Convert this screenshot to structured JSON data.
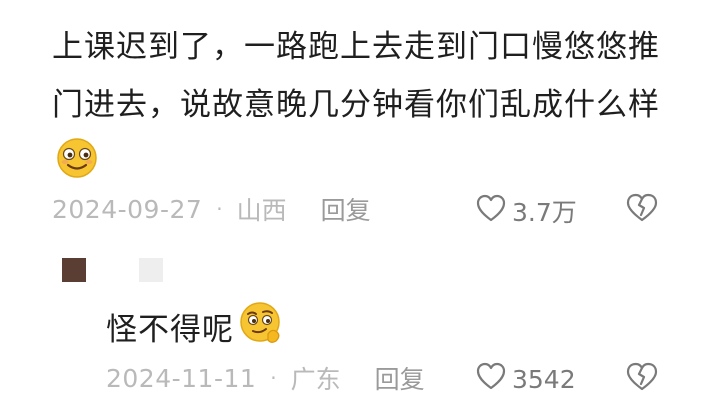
{
  "comment": {
    "text": "上课迟到了，一路跑上去走到门口慢悠悠推门进去，说故意晚几分钟看你们乱成什么样",
    "emoji_icon": "smirk-face-icon",
    "date": "2024-09-27",
    "location": "山西",
    "reply_label": "回复",
    "like_count": "3.7万"
  },
  "reply": {
    "text": "怪不得呢",
    "emoji_icon": "thinking-face-icon",
    "date": "2024-11-11",
    "location": "广东",
    "reply_label": "回复",
    "like_count": "3542"
  },
  "separator": "·",
  "colors": {
    "text": "#1f1f1f",
    "meta": "#b9b9b9",
    "icon": "#7a7a7a",
    "emoji": "#f7c531"
  }
}
